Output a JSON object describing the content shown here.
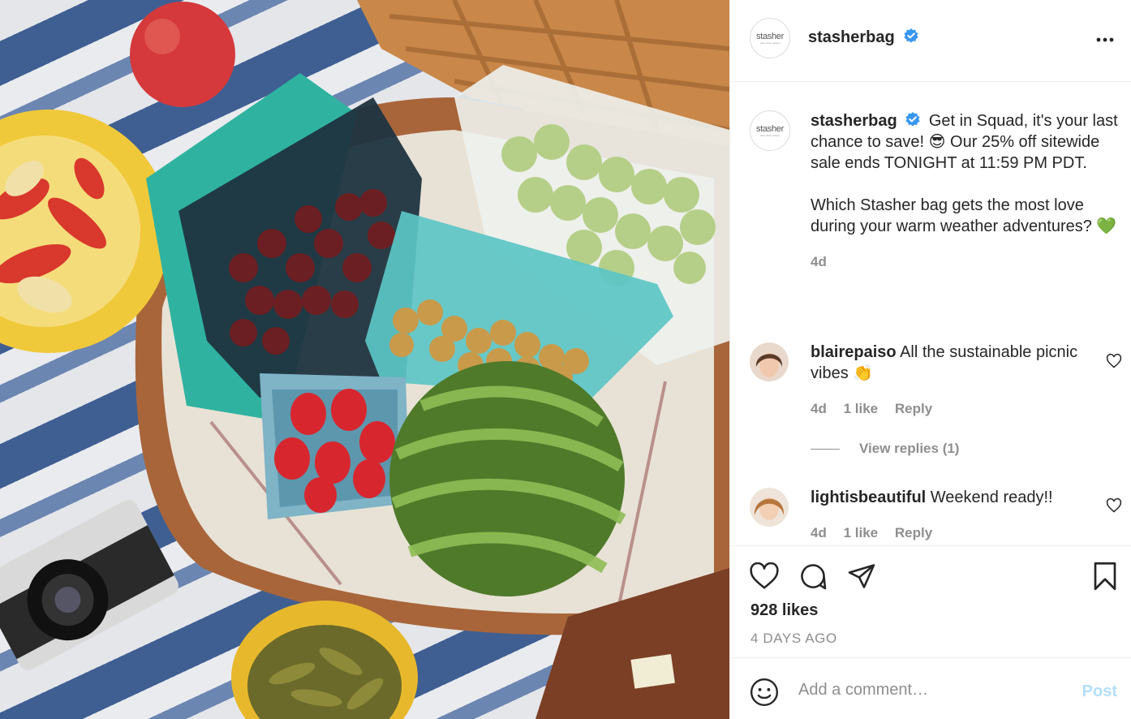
{
  "post": {
    "username": "stasherbag",
    "logo_text": "stasher",
    "logo_tagline": "save what matters",
    "more_icon": "more-horizontal-icon"
  },
  "caption": {
    "username": "stasherbag",
    "line1": "Get in Squad, it's your last chance to save! 😎 Our 25% off sitewide sale ends TONIGHT at 11:59 PM PDT.",
    "line2": "Which Stasher bag gets the most love during your warm weather adventures? 💚",
    "time": "4d"
  },
  "comments": [
    {
      "username": "blairepaiso",
      "text": "All the sustainable picnic vibes 👏",
      "time": "4d",
      "likes": "1 like",
      "reply": "Reply",
      "view_replies": "View replies (1)"
    },
    {
      "username": "lightisbeautiful",
      "text": "Weekend ready!!",
      "time": "4d",
      "likes": "1 like",
      "reply": "Reply"
    }
  ],
  "actions": {
    "likes": "928 likes",
    "date": "4 DAYS AGO"
  },
  "composer": {
    "placeholder": "Add a comment…",
    "post_label": "Post"
  },
  "colors": {
    "verified": "#3897f0",
    "post_button_disabled": "#b2dffc",
    "muted_text": "#8e8e8e"
  }
}
